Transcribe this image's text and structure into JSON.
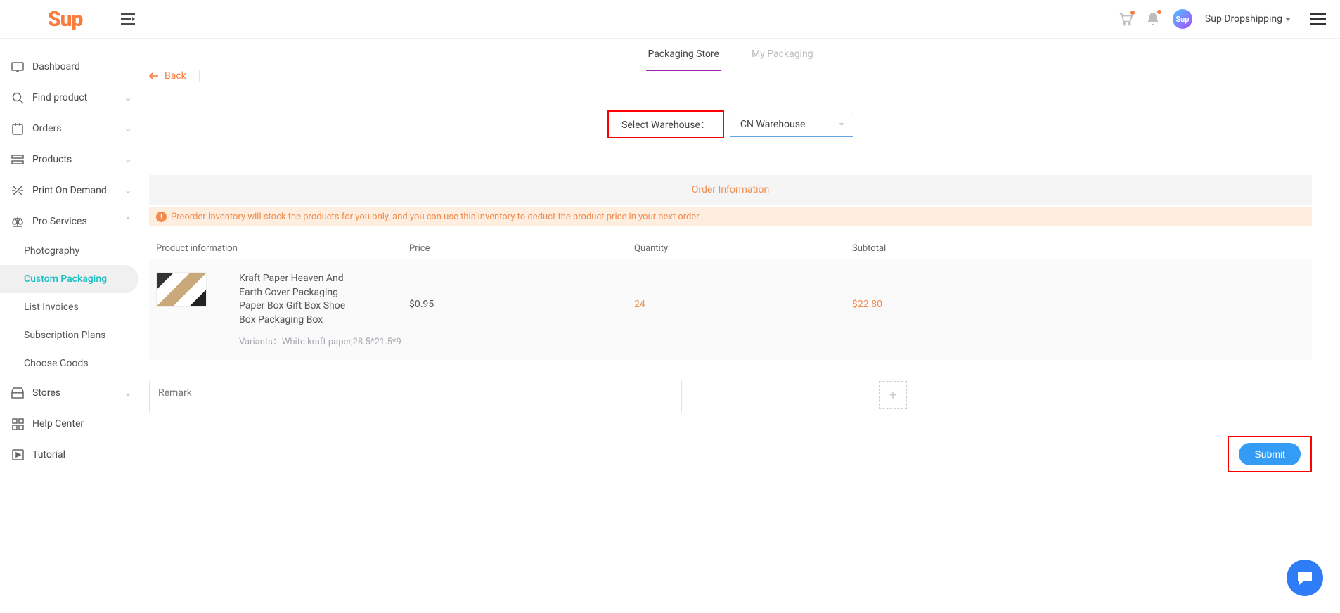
{
  "header": {
    "logo": "Sup",
    "user": "Sup Dropshipping"
  },
  "sidebar": {
    "items": [
      {
        "icon": "dashboard",
        "label": "Dashboard",
        "chev": false
      },
      {
        "icon": "search",
        "label": "Find product",
        "chev": true
      },
      {
        "icon": "orders",
        "label": "Orders",
        "chev": true
      },
      {
        "icon": "products",
        "label": "Products",
        "chev": true
      },
      {
        "icon": "print",
        "label": "Print On Demand",
        "chev": true
      },
      {
        "icon": "scale",
        "label": "Pro Services",
        "chev": true,
        "open": true
      }
    ],
    "sub": [
      {
        "label": "Photography",
        "active": false
      },
      {
        "label": "Custom Packaging",
        "active": true
      },
      {
        "label": "List Invoices",
        "active": false
      },
      {
        "label": "Subscription Plans",
        "active": false
      },
      {
        "label": "Choose Goods",
        "active": false
      }
    ],
    "items2": [
      {
        "icon": "stores",
        "label": "Stores",
        "chev": true
      },
      {
        "icon": "help",
        "label": "Help Center",
        "chev": false
      },
      {
        "icon": "tutorial",
        "label": "Tutorial",
        "chev": false
      }
    ]
  },
  "tabs": [
    {
      "label": "Packaging Store",
      "active": true
    },
    {
      "label": "My Packaging",
      "active": false
    }
  ],
  "back_label": "Back",
  "warehouse": {
    "label": "Select Warehouse：",
    "value": "CN Warehouse"
  },
  "section_title": "Order Information",
  "warn": "Preorder Inventory will stock the products for you only, and you can use this inventory to deduct the product price in your next order.",
  "columns": {
    "prod": "Product information",
    "price": "Price",
    "qty": "Quantity",
    "sub": "Subtotal"
  },
  "row": {
    "name": "Kraft Paper Heaven And Earth Cover Packaging Paper Box Gift Box Shoe Box Packaging Box",
    "variants_label": "Variants：",
    "variants_value": "White kraft paper,28.5*21.5*9",
    "price": "$0.95",
    "qty": "24",
    "subtotal": "$22.80"
  },
  "remark_placeholder": "Remark",
  "submit_label": "Submit"
}
